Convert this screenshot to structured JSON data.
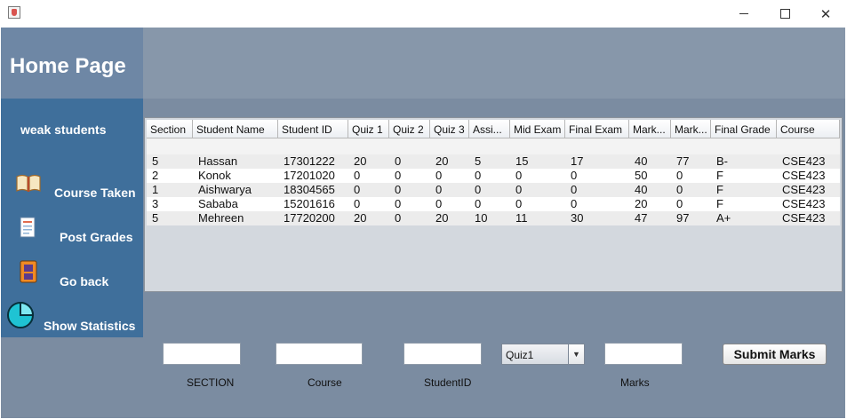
{
  "window": {
    "minimize_glyph": "",
    "maximize_glyph": "",
    "close_glyph": "✕"
  },
  "sidebar": {
    "title": "Home Page",
    "items": [
      {
        "label": "weak students",
        "icon": ""
      },
      {
        "label": "Course Taken",
        "icon": "book-icon"
      },
      {
        "label": "Post Grades",
        "icon": "form-icon"
      },
      {
        "label": "Go back",
        "icon": "door-icon"
      },
      {
        "label": "Show Statistics",
        "icon": "pie-chart-icon"
      }
    ]
  },
  "table": {
    "columns": [
      "Section",
      "Student Name",
      "Student ID",
      "Quiz 1",
      "Quiz 2",
      "Quiz 3",
      "Assi...",
      "Mid Exam",
      "Final Exam",
      "Mark...",
      "Mark...",
      "Final Grade",
      "Course"
    ],
    "rows": [
      [
        "5",
        "Hassan",
        "17301222",
        "20",
        "0",
        "20",
        "5",
        "15",
        "17",
        "40",
        "77",
        "B-",
        "CSE423"
      ],
      [
        "2",
        "Konok",
        "17201020",
        "0",
        "0",
        "0",
        "0",
        "0",
        "0",
        "50",
        "0",
        "F",
        "CSE423"
      ],
      [
        "1",
        "Aishwarya",
        "18304565",
        "0",
        "0",
        "0",
        "0",
        "0",
        "0",
        "40",
        "0",
        "F",
        "CSE423"
      ],
      [
        "3",
        "Sababa",
        "15201616",
        "0",
        "0",
        "0",
        "0",
        "0",
        "0",
        "20",
        "0",
        "F",
        "CSE423"
      ],
      [
        "5",
        "Mehreen",
        "17720200",
        "20",
        "0",
        "20",
        "10",
        "11",
        "30",
        "47",
        "97",
        "A+",
        "CSE423"
      ]
    ]
  },
  "form": {
    "section_label": "SECTION",
    "course_label": "Course",
    "student_id_label": "StudentID",
    "marks_label": "Marks",
    "section_value": "",
    "course_value": "",
    "student_id_value": "",
    "marks_value": "",
    "assessment_selected": "Quiz1",
    "submit_label": "Submit Marks"
  }
}
